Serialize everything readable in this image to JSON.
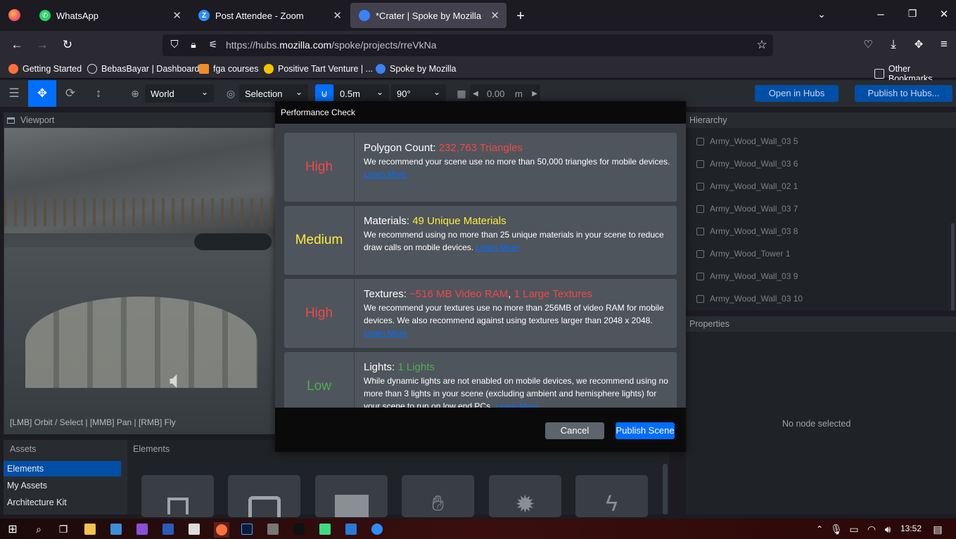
{
  "browser": {
    "tabs": [
      {
        "label": "WhatsApp",
        "icon": "whatsapp-icon",
        "color": "#25d366"
      },
      {
        "label": "Post Attendee - Zoom",
        "icon": "zoom-icon",
        "color": "#2d8cff"
      },
      {
        "label": "*Crater | Spoke by Mozilla",
        "icon": "spoke-icon",
        "color": "#3b82f6"
      }
    ],
    "url_prefix": "https://hubs.",
    "url_domain": "mozilla.com",
    "url_path": "/spoke/projects/rreVkNa",
    "bookmarks": [
      {
        "label": "Getting Started",
        "color": "#ff7139"
      },
      {
        "label": "BebasBayar | Dashboard",
        "color": "#cccccc"
      },
      {
        "label": "fga courses",
        "color": "#f28c28"
      },
      {
        "label": "Positive Tart Venture | ...",
        "color": "#f5c400"
      },
      {
        "label": "Spoke by Mozilla",
        "color": "#3b82f6"
      }
    ],
    "other_bookmarks": "Other Bookmarks"
  },
  "toolbar": {
    "space": "World",
    "transform_pivot": "Selection",
    "snap": "0.5m",
    "rotation": "90°",
    "grid": "0.00",
    "grid_unit": "m",
    "open_hubs": "Open in Hubs",
    "publish_hubs": "Publish to Hubs..."
  },
  "viewport": {
    "title": "Viewport",
    "hint": "[LMB] Orbit / Select | [MMB] Pan | [RMB] Fly"
  },
  "assets": {
    "title": "Assets",
    "items": [
      "Elements",
      "My Assets",
      "Architecture Kit"
    ]
  },
  "elements": {
    "title": "Elements"
  },
  "hierarchy": {
    "title": "Hierarchy",
    "items": [
      "Army_Wood_Wall_03 5",
      "Army_Wood_Wall_03 6",
      "Army_Wood_Wall_02 1",
      "Army_Wood_Wall_03 7",
      "Army_Wood_Wall_03 8",
      "Army_Wood_Tower 1",
      "Army_Wood_Wall_03 9",
      "Army_Wood_Wall_03 10"
    ]
  },
  "properties": {
    "title": "Properties",
    "empty": "No node selected"
  },
  "modal": {
    "title": "Performance Check",
    "checks": [
      {
        "severity": "High",
        "label": "Polygon Count: ",
        "value": "232,763 Triangles",
        "value2": "",
        "desc": "We recommend your scene use no more than 50,000 triangles for mobile devices.",
        "learn": "Learn More"
      },
      {
        "severity": "Medium",
        "label": "Materials: ",
        "value": "49 Unique Materials",
        "value2": "",
        "desc": "We recommend using no more than 25 unique materials in your scene to reduce draw calls on mobile devices.",
        "learn": "Learn More"
      },
      {
        "severity": "High",
        "label": "Textures: ",
        "value": "~516 MB Video RAM",
        "value2": "1 Large Textures",
        "desc": "We recommend your textures use no more than 256MB of video RAM for mobile devices. We also recommend against using textures larger than 2048 x 2048.",
        "learn": "Learn More"
      },
      {
        "severity": "Low",
        "label": "Lights: ",
        "value": "1 Lights",
        "value2": "",
        "desc": "While dynamic lights are not enabled on mobile devices, we recommend using no more than 3 lights in your scene (excluding ambient and hemisphere lights) for your scene to run on low end PCs.",
        "learn": "Learn More"
      }
    ],
    "cancel": "Cancel",
    "publish": "Publish Scene"
  },
  "taskbar": {
    "time": "13:52"
  }
}
